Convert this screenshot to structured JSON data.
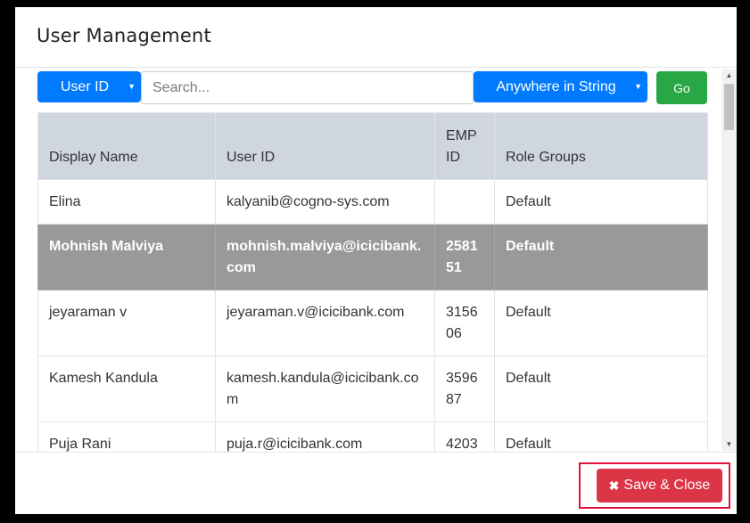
{
  "modal": {
    "title": "User Management"
  },
  "toolbar": {
    "field_select": {
      "label": "User ID"
    },
    "search": {
      "placeholder": "Search...",
      "value": ""
    },
    "match_select": {
      "label": "Anywhere in String"
    },
    "go_label": "Go"
  },
  "table": {
    "headers": [
      "Display Name",
      "User ID",
      "EMP ID",
      "Role Groups"
    ],
    "rows": [
      {
        "display_name": "Elina",
        "user_id": "kalyanib@cogno-sys.com",
        "emp_id": "",
        "role_groups": "Default"
      },
      {
        "display_name": "Mohnish Malviya",
        "user_id": "mohnish.malviya@icicibank.com",
        "emp_id": "258151",
        "role_groups": "Default"
      },
      {
        "display_name": "jeyaraman v",
        "user_id": "jeyaraman.v@icicibank.com",
        "emp_id": "315606",
        "role_groups": "Default"
      },
      {
        "display_name": "Kamesh Kandula",
        "user_id": "kamesh.kandula@icicibank.com",
        "emp_id": "359687",
        "role_groups": "Default"
      },
      {
        "display_name": "Puja Rani",
        "user_id": "puja.r@icicibank.com",
        "emp_id": "4203",
        "role_groups": "Default"
      }
    ]
  },
  "footer": {
    "save_close_label": "Save & Close"
  },
  "icons": {
    "close": "x-icon",
    "caret": "caret-down-icon"
  },
  "colors": {
    "primary": "#007bff",
    "success": "#28a745",
    "danger": "#dc3545",
    "selected_row": "#999999",
    "header_bg": "#cfd6e0"
  }
}
